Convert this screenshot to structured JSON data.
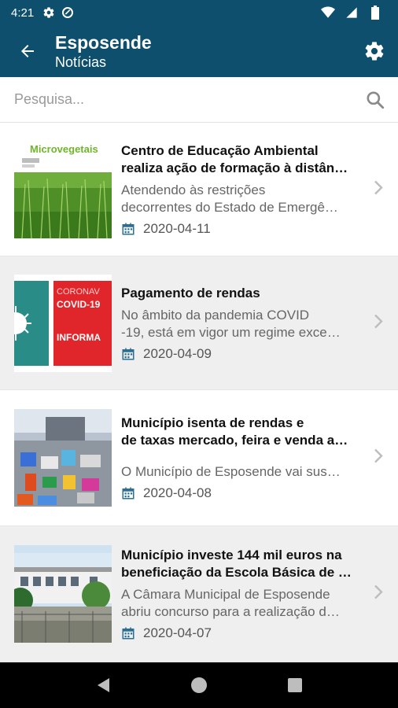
{
  "status_bar": {
    "time": "4:21"
  },
  "app_bar": {
    "title": "Esposende",
    "subtitle": "Notícias"
  },
  "search": {
    "placeholder": "Pesquisa..."
  },
  "news": [
    {
      "title_line1": "Centro de Educação Ambiental",
      "title_line2": "realiza ação de formação à distân…",
      "summary_line1": "Atendendo às restrições",
      "summary_line2": "decorrentes do Estado de Emergê…",
      "date": "2020-04-11",
      "thumb_text": "Microvegetais"
    },
    {
      "title_line1": "Pagamento de rendas",
      "title_line2": "",
      "summary_line1": "No âmbito da pandemia COVID",
      "summary_line2": "-19, está em vigor um regime exce…",
      "date": "2020-04-09",
      "thumb_text_1": "CORONAV",
      "thumb_text_2": "COVID-19",
      "thumb_text_3": "INFORMA"
    },
    {
      "title_line1": "Município isenta de rendas e",
      "title_line2": "de taxas mercado, feira e venda a…",
      "summary_line1": "O Município de Esposende vai sus…",
      "summary_line2": "",
      "date": "2020-04-08"
    },
    {
      "title_line1": "Município investe 144 mil euros na",
      "title_line2": "beneficiação da Escola Básica de …",
      "summary_line1": "A Câmara Municipal de Esposende",
      "summary_line2": "abriu concurso para a realização d…",
      "date": "2020-04-07"
    }
  ]
}
